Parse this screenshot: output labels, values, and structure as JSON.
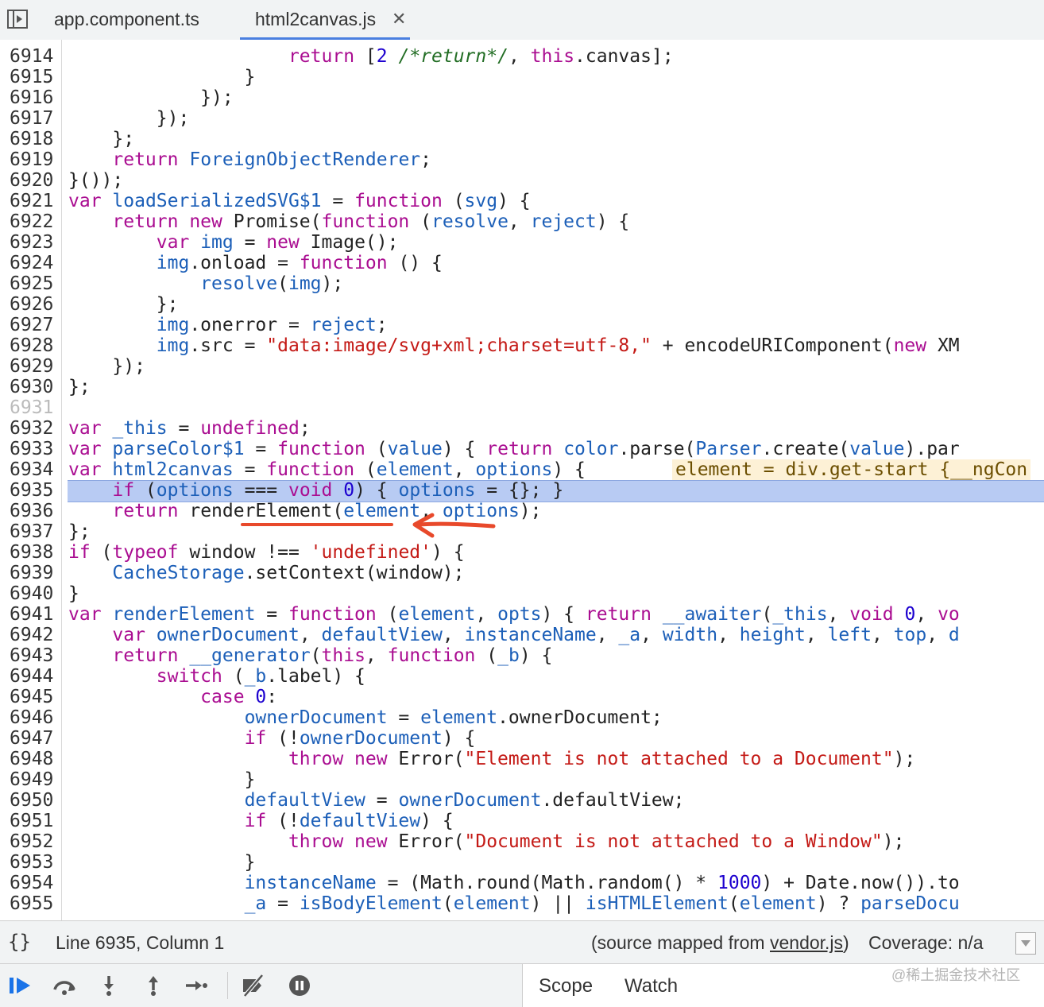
{
  "tabs": [
    {
      "label": "app.component.ts"
    },
    {
      "label": "html2canvas.js"
    }
  ],
  "close_glyph": "✕",
  "code": {
    "lines": [
      {
        "num": "6914",
        "html": "                    <span class=\"k\">return</span> [<span class=\"n\">2</span> <span class=\"c\">/*return*/</span>, <span class=\"k\">this</span>.canvas];"
      },
      {
        "num": "6915",
        "html": "                }"
      },
      {
        "num": "6916",
        "html": "            });"
      },
      {
        "num": "6917",
        "html": "        });"
      },
      {
        "num": "6918",
        "html": "    };"
      },
      {
        "num": "6919",
        "html": "    <span class=\"k\">return</span> <span class=\"f\">ForeignObjectRenderer</span>;"
      },
      {
        "num": "6920",
        "html": "}());"
      },
      {
        "num": "6921",
        "html": "<span class=\"k\">var</span> <span class=\"f\">loadSerializedSVG$1</span> = <span class=\"k\">function</span> (<span class=\"f\">svg</span>) {"
      },
      {
        "num": "6922",
        "html": "    <span class=\"k\">return new</span> Promise(<span class=\"k\">function</span> (<span class=\"f\">resolve</span>, <span class=\"f\">reject</span>) {"
      },
      {
        "num": "6923",
        "html": "        <span class=\"k\">var</span> <span class=\"f\">img</span> = <span class=\"k\">new</span> Image();"
      },
      {
        "num": "6924",
        "html": "        <span class=\"f\">img</span>.onload = <span class=\"k\">function</span> () {"
      },
      {
        "num": "6925",
        "html": "            <span class=\"f\">resolve</span>(<span class=\"f\">img</span>);"
      },
      {
        "num": "6926",
        "html": "        };"
      },
      {
        "num": "6927",
        "html": "        <span class=\"f\">img</span>.onerror = <span class=\"f\">reject</span>;"
      },
      {
        "num": "6928",
        "html": "        <span class=\"f\">img</span>.src = <span class=\"s\">\"data:image/svg+xml;charset=utf-8,\"</span> + encodeURIComponent(<span class=\"k\">new</span> XM"
      },
      {
        "num": "6929",
        "html": "    });"
      },
      {
        "num": "6930",
        "html": "};"
      },
      {
        "num": "6931",
        "html": "",
        "dim": true
      },
      {
        "num": "6932",
        "html": "<span class=\"k\">var</span> <span class=\"f\">_this</span> = <span class=\"k\">undefined</span>;"
      },
      {
        "num": "6933",
        "html": "<span class=\"k\">var</span> <span class=\"f\">parseColor$1</span> = <span class=\"k\">function</span> (<span class=\"f\">value</span>) { <span class=\"k\">return</span> <span class=\"f\">color</span>.parse(<span class=\"f\">Parser</span>.create(<span class=\"f\">value</span>).par"
      },
      {
        "num": "6934",
        "html": "<span class=\"k\">var</span> <span class=\"f\">html2canvas</span> = <span class=\"k\">function</span> (<span class=\"f\">element</span>, <span class=\"f\">options</span>) { ",
        "inline": "element = div.get-start {__ngCon"
      },
      {
        "num": "6935",
        "html": "    <span class=\"k\">if</span> (<span class=\"f\">options</span> === <span class=\"k\">void</span> <span class=\"n\">0</span>) { <span class=\"f\">options</span> = {}; }",
        "highlight": true
      },
      {
        "num": "6936",
        "html": "    <span class=\"k\">return</span> <span class=\"p\">renderElement</span>(<span class=\"f\">element</span>, <span class=\"f\">options</span>);"
      },
      {
        "num": "6937",
        "html": "};"
      },
      {
        "num": "6938",
        "html": "<span class=\"k\">if</span> (<span class=\"k\">typeof</span> window !== <span class=\"s\">'undefined'</span>) {"
      },
      {
        "num": "6939",
        "html": "    <span class=\"f\">CacheStorage</span>.setContext(window);"
      },
      {
        "num": "6940",
        "html": "}"
      },
      {
        "num": "6941",
        "html": "<span class=\"k\">var</span> <span class=\"f\">renderElement</span> = <span class=\"k\">function</span> (<span class=\"f\">element</span>, <span class=\"f\">opts</span>) { <span class=\"k\">return</span> <span class=\"f\">__awaiter</span>(<span class=\"f\">_this</span>, <span class=\"k\">void</span> <span class=\"n\">0</span>, <span class=\"k\">vo</span>"
      },
      {
        "num": "6942",
        "html": "    <span class=\"k\">var</span> <span class=\"f\">ownerDocument</span>, <span class=\"f\">defaultView</span>, <span class=\"f\">instanceName</span>, <span class=\"f\">_a</span>, <span class=\"f\">width</span>, <span class=\"f\">height</span>, <span class=\"f\">left</span>, <span class=\"f\">top</span>, <span class=\"f\">d</span>"
      },
      {
        "num": "6943",
        "html": "    <span class=\"k\">return</span> <span class=\"f\">__generator</span>(<span class=\"k\">this</span>, <span class=\"k\">function</span> (<span class=\"f\">_b</span>) {"
      },
      {
        "num": "6944",
        "html": "        <span class=\"k\">switch</span> (<span class=\"f\">_b</span>.label) {"
      },
      {
        "num": "6945",
        "html": "            <span class=\"k\">case</span> <span class=\"n\">0</span>:"
      },
      {
        "num": "6946",
        "html": "                <span class=\"f\">ownerDocument</span> = <span class=\"f\">element</span>.ownerDocument;"
      },
      {
        "num": "6947",
        "html": "                <span class=\"k\">if</span> (!<span class=\"f\">ownerDocument</span>) {"
      },
      {
        "num": "6948",
        "html": "                    <span class=\"k\">throw new</span> Error(<span class=\"s\">\"Element is not attached to a Document\"</span>);"
      },
      {
        "num": "6949",
        "html": "                }"
      },
      {
        "num": "6950",
        "html": "                <span class=\"f\">defaultView</span> = <span class=\"f\">ownerDocument</span>.defaultView;"
      },
      {
        "num": "6951",
        "html": "                <span class=\"k\">if</span> (!<span class=\"f\">defaultView</span>) {"
      },
      {
        "num": "6952",
        "html": "                    <span class=\"k\">throw new</span> Error(<span class=\"s\">\"Document is not attached to a Window\"</span>);"
      },
      {
        "num": "6953",
        "html": "                }"
      },
      {
        "num": "6954",
        "html": "                <span class=\"f\">instanceName</span> = (Math.round(Math.random() * <span class=\"n\">1000</span>) + Date.now()).to"
      },
      {
        "num": "6955",
        "html": "                <span class=\"f\">_a</span> = <span class=\"f\">isBodyElement</span>(<span class=\"f\">element</span>) || <span class=\"f\">isHTMLElement</span>(<span class=\"f\">element</span>) ? <span class=\"f\">parseDocu</span>"
      }
    ]
  },
  "status": {
    "braces": "{}",
    "position": "Line 6935, Column 1",
    "source_prefix": "(source mapped from ",
    "source_file": "vendor.js",
    "source_suffix": ")",
    "coverage": "Coverage: n/a"
  },
  "debug": {
    "tabs": [
      "Scope",
      "Watch"
    ],
    "buttons": [
      "resume-icon",
      "step-over-icon",
      "step-into-icon",
      "step-out-icon",
      "step-icon",
      "deactivate-breakpoints-icon",
      "pause-on-exceptions-icon"
    ]
  },
  "watermark": "@稀土掘金技术社区",
  "colors": {
    "keyword": "#aa0d91",
    "identifier": "#1c5fb8",
    "string": "#c41a16",
    "highlight": "#b8cbf3",
    "annotation": "#e8492b",
    "debug_accent": "#1a73e8"
  }
}
